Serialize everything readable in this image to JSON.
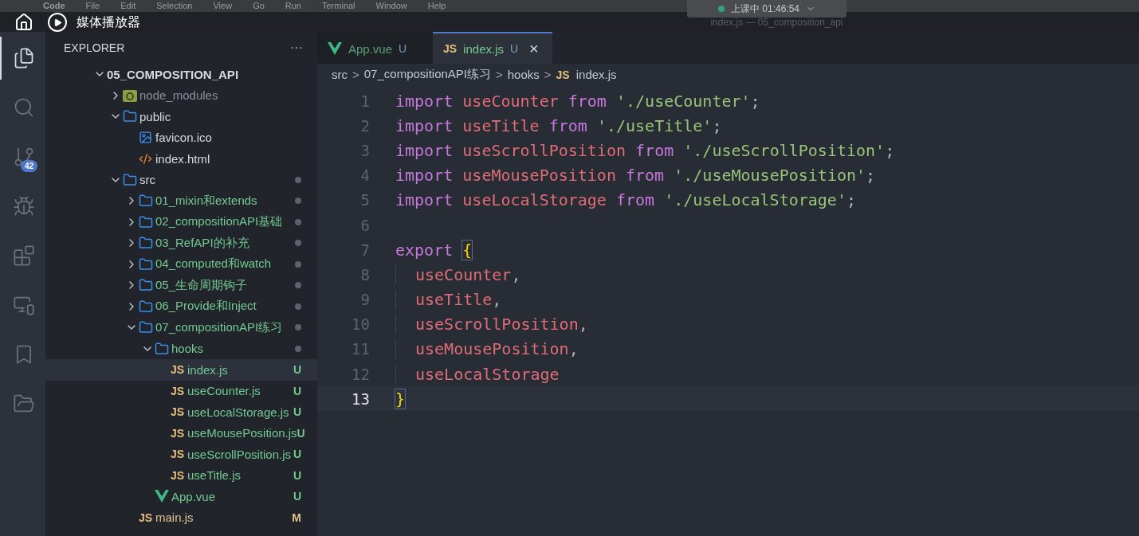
{
  "menu_bar": [
    "Code",
    "File",
    "Edit",
    "Selection",
    "View",
    "Go",
    "Run",
    "Terminal",
    "Window",
    "Help"
  ],
  "media_overlay": {
    "title": "媒体播放器"
  },
  "recording_pill": {
    "label": "上课中 01:46:54"
  },
  "window": {
    "title": "index.js — 05_composition_api"
  },
  "activity_bar": [
    {
      "kind": "files",
      "selected": true
    },
    {
      "kind": "search",
      "selected": false
    },
    {
      "kind": "source-control",
      "selected": false,
      "badge": "42"
    },
    {
      "kind": "run-debug",
      "selected": false
    },
    {
      "kind": "extensions",
      "selected": false
    },
    {
      "kind": "remote",
      "selected": false
    },
    {
      "kind": "bookmark",
      "selected": false
    },
    {
      "kind": "folders",
      "selected": false
    }
  ],
  "sidebar": {
    "title": "EXPLORER",
    "more": "···",
    "root": {
      "label": "05_COMPOSITION_API",
      "expanded": true,
      "children": [
        {
          "label": "node_modules",
          "kind": "node-folder",
          "expanded": false,
          "color": "#8b9098"
        },
        {
          "label": "public",
          "kind": "folder",
          "expanded": true,
          "color": "#d7dae0",
          "children": [
            {
              "label": "favicon.ico",
              "kind": "image",
              "color": "#d7dae0"
            },
            {
              "label": "index.html",
              "kind": "html",
              "color": "#d7dae0"
            }
          ]
        },
        {
          "label": "src",
          "kind": "folder",
          "expanded": true,
          "color": "#d7dae0",
          "dot": true,
          "children": [
            {
              "label": "01_mixin和extends",
              "kind": "folder",
              "expanded": false,
              "color": "#73c991",
              "dot": true
            },
            {
              "label": "02_compositionAPI基础",
              "kind": "folder",
              "expanded": false,
              "color": "#73c991",
              "dot": true
            },
            {
              "label": "03_RefAPI的补充",
              "kind": "folder",
              "expanded": false,
              "color": "#73c991",
              "dot": true
            },
            {
              "label": "04_computed和watch",
              "kind": "folder",
              "expanded": false,
              "color": "#73c991",
              "dot": true
            },
            {
              "label": "05_生命周期钩子",
              "kind": "folder",
              "expanded": false,
              "color": "#73c991",
              "dot": true
            },
            {
              "label": "06_Provide和Inject",
              "kind": "folder",
              "expanded": false,
              "color": "#73c991",
              "dot": true
            },
            {
              "label": "07_compositionAPI练习",
              "kind": "folder",
              "expanded": true,
              "color": "#73c991",
              "dot": true,
              "children": [
                {
                  "label": "hooks",
                  "kind": "folder",
                  "expanded": true,
                  "color": "#73c991",
                  "dot": true,
                  "children": [
                    {
                      "label": "index.js",
                      "kind": "js",
                      "icon": "JS",
                      "color": "#73c991",
                      "badge": "U",
                      "selected": true
                    },
                    {
                      "label": "useCounter.js",
                      "kind": "js",
                      "icon": "JS",
                      "color": "#73c991",
                      "badge": "U",
                      "selected": false
                    },
                    {
                      "label": "useLocalStorage.js",
                      "kind": "js",
                      "icon": "JS",
                      "color": "#73c991",
                      "badge": "U",
                      "selected": false
                    },
                    {
                      "label": "useMousePosition.js",
                      "kind": "js",
                      "icon": "JS",
                      "color": "#73c991",
                      "badge": "U",
                      "selected": false
                    },
                    {
                      "label": "useScrollPosition.js",
                      "kind": "js",
                      "icon": "JS",
                      "color": "#73c991",
                      "badge": "U",
                      "selected": false
                    },
                    {
                      "label": "useTitle.js",
                      "kind": "js",
                      "icon": "JS",
                      "color": "#73c991",
                      "badge": "U",
                      "selected": false
                    }
                  ]
                },
                {
                  "label": "App.vue",
                  "kind": "vue",
                  "color": "#73c991",
                  "badge": "U",
                  "selected": false
                }
              ]
            },
            {
              "label": "main.js",
              "kind": "js",
              "icon": "JS",
              "color": "#e2c08d",
              "badge": "M",
              "selected": false
            }
          ]
        }
      ]
    }
  },
  "tabs": [
    {
      "label": "App.vue",
      "kind": "vue",
      "badge": "U",
      "selected": false
    },
    {
      "label": "index.js",
      "kind": "js",
      "icon": "JS",
      "badge": "U",
      "selected": true,
      "close": "×"
    }
  ],
  "breadcrumb": [
    {
      "label": "src"
    },
    {
      "label": "07_compositionAPI练习"
    },
    {
      "label": "hooks"
    },
    {
      "label": "index.js",
      "kind": "js",
      "icon": "JS"
    }
  ],
  "separator": ">",
  "code": [
    {
      "number": "1",
      "tokens": [
        {
          "kind": "keyword",
          "text": "import "
        },
        {
          "kind": "variable",
          "text": "useCounter "
        },
        {
          "kind": "keyword",
          "text": "from "
        },
        {
          "kind": "string",
          "text": "'./useCounter'"
        },
        {
          "kind": "punct",
          "text": ";"
        }
      ]
    },
    {
      "number": "2",
      "tokens": [
        {
          "kind": "keyword",
          "text": "import "
        },
        {
          "kind": "variable",
          "text": "useTitle "
        },
        {
          "kind": "keyword",
          "text": "from "
        },
        {
          "kind": "string",
          "text": "'./useTitle'"
        },
        {
          "kind": "punct",
          "text": ";"
        }
      ]
    },
    {
      "number": "3",
      "tokens": [
        {
          "kind": "keyword",
          "text": "import "
        },
        {
          "kind": "variable",
          "text": "useScrollPosition "
        },
        {
          "kind": "keyword",
          "text": "from "
        },
        {
          "kind": "string",
          "text": "'./useScrollPosition'"
        },
        {
          "kind": "punct",
          "text": ";"
        }
      ]
    },
    {
      "number": "4",
      "tokens": [
        {
          "kind": "keyword",
          "text": "import "
        },
        {
          "kind": "variable",
          "text": "useMousePosition "
        },
        {
          "kind": "keyword",
          "text": "from "
        },
        {
          "kind": "string",
          "text": "'./useMousePosition'"
        },
        {
          "kind": "punct",
          "text": ";"
        }
      ]
    },
    {
      "number": "5",
      "tokens": [
        {
          "kind": "keyword",
          "text": "import "
        },
        {
          "kind": "variable",
          "text": "useLocalStorage "
        },
        {
          "kind": "keyword",
          "text": "from "
        },
        {
          "kind": "string",
          "text": "'./useLocalStorage'"
        },
        {
          "kind": "punct",
          "text": ";"
        }
      ]
    },
    {
      "number": "6"
    },
    {
      "number": "7",
      "tokens": [
        {
          "kind": "keyword",
          "text": "export "
        },
        {
          "kind": "brace",
          "text": "{"
        }
      ]
    },
    {
      "number": "8",
      "indent": true,
      "tokens": [
        {
          "kind": "variable",
          "text": "useCounter"
        },
        {
          "kind": "punct",
          "text": ","
        }
      ]
    },
    {
      "number": "9",
      "indent": true,
      "tokens": [
        {
          "kind": "variable",
          "text": "useTitle"
        },
        {
          "kind": "punct",
          "text": ","
        }
      ]
    },
    {
      "number": "10",
      "indent": true,
      "tokens": [
        {
          "kind": "variable",
          "text": "useScrollPosition"
        },
        {
          "kind": "punct",
          "text": ","
        }
      ]
    },
    {
      "number": "11",
      "indent": true,
      "tokens": [
        {
          "kind": "variable",
          "text": "useMousePosition"
        },
        {
          "kind": "punct",
          "text": ","
        }
      ]
    },
    {
      "number": "12",
      "indent": true,
      "tokens": [
        {
          "kind": "variable",
          "text": "useLocalStorage"
        }
      ]
    },
    {
      "number": "13",
      "current": true,
      "tokens": [
        {
          "kind": "brace",
          "text": "}"
        }
      ]
    }
  ]
}
